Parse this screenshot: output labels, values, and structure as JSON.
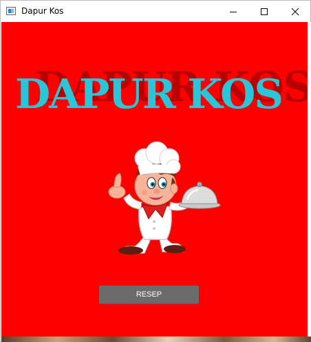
{
  "window": {
    "title": "Dapur Kos",
    "controls": {
      "minimize": "minimize-icon",
      "maximize": "maximize-icon",
      "close": "close-icon"
    }
  },
  "main": {
    "background_color": "#ff0000",
    "brand_title": "DAPUR KOS",
    "brand_shadow": "DAPUR KOS",
    "title_color": "#27c6d8",
    "illustration": "chef-illustration",
    "resep_button": {
      "label": "RESEP",
      "color": "#6b6b6b"
    }
  }
}
